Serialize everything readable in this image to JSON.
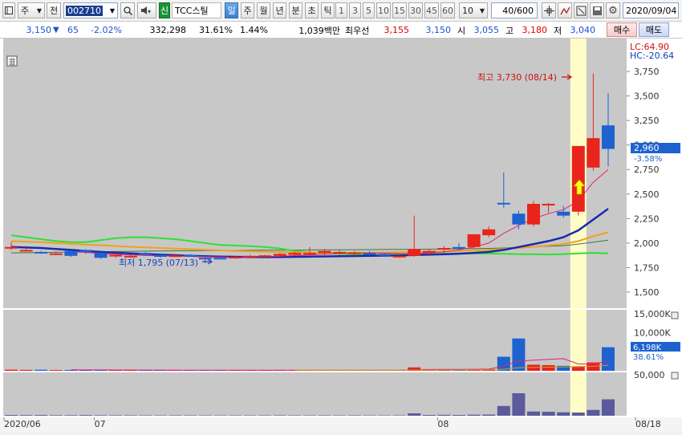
{
  "toolbar": {
    "market_label": "주",
    "prev_label": "전",
    "code": "002710",
    "badge": "신",
    "name": "TCC스틸",
    "periods": [
      "일",
      "주",
      "월",
      "년",
      "분",
      "초",
      "틱"
    ],
    "selected_period": "일",
    "intervals": [
      "1",
      "3",
      "5",
      "10",
      "15",
      "30",
      "45",
      "60"
    ],
    "interval_value": "10",
    "count": "40/600",
    "date": "2020/09/04"
  },
  "quote": {
    "price": "3,150",
    "change": "65",
    "change_pct": "-2.02%",
    "volume": "332,298",
    "ratio1": "31.61%",
    "ratio2": "1.44%",
    "amount": "1,039백만",
    "best_bid_label": "최우선",
    "best_ask": "3,155",
    "best_bid": "3,150",
    "open_label": "시",
    "open": "3,055",
    "high_label": "고",
    "high": "3,180",
    "low_label": "저",
    "low": "3,040",
    "buy_label": "매수",
    "sell_label": "매도"
  },
  "indicators": {
    "lc": "LC:64.90",
    "hc": "HC:-20.64"
  },
  "annotations": {
    "high_note": "최고 3,730 (08/14)",
    "low_note": "최저 1,795 (07/13)"
  },
  "price_tag": "2,960",
  "price_tag_pct": "-3.58%",
  "volume_tag": "6,198K",
  "volume_tag_pct": "38.61%",
  "colors": {
    "up": "#e8241c",
    "down": "#1e62d0",
    "highlight": "#fffcc8",
    "ma5": "#e0207a",
    "ma20": "#1a2aa8",
    "ma60": "#f0a020",
    "ma120": "#30e030",
    "ma240": "#3a7a3a"
  },
  "chart_data": {
    "type": "candlestick",
    "price_ticks": [
      "3,750",
      "3,500",
      "3,250",
      "3,000",
      "2,750",
      "2,500",
      "2,250",
      "2,000",
      "1,750",
      "1,500"
    ],
    "volume_ticks": [
      "15,000K",
      "10,000K"
    ],
    "volume2_ticks": [
      "50,000"
    ],
    "x_labels": [
      {
        "label": "2020/06",
        "index": 0
      },
      {
        "label": "07",
        "index": 6
      },
      {
        "label": "08",
        "index": 29
      },
      {
        "label": "08/18",
        "index": 42
      }
    ],
    "highlight_index": 38,
    "candles": [
      {
        "o": 1950,
        "h": 2010,
        "l": 1930,
        "c": 1960
      },
      {
        "o": 1930,
        "h": 1960,
        "l": 1920,
        "c": 1930
      },
      {
        "o": 1910,
        "h": 1920,
        "l": 1890,
        "c": 1900
      },
      {
        "o": 1890,
        "h": 1915,
        "l": 1880,
        "c": 1895
      },
      {
        "o": 1920,
        "h": 1930,
        "l": 1860,
        "c": 1870
      },
      {
        "o": 1930,
        "h": 1940,
        "l": 1890,
        "c": 1910
      },
      {
        "o": 1900,
        "h": 1910,
        "l": 1840,
        "c": 1850
      },
      {
        "o": 1870,
        "h": 1890,
        "l": 1850,
        "c": 1880
      },
      {
        "o": 1860,
        "h": 1880,
        "l": 1850,
        "c": 1870
      },
      {
        "o": 1900,
        "h": 1910,
        "l": 1870,
        "c": 1880
      },
      {
        "o": 1880,
        "h": 1890,
        "l": 1850,
        "c": 1860
      },
      {
        "o": 1870,
        "h": 1890,
        "l": 1860,
        "c": 1875
      },
      {
        "o": 1880,
        "h": 1890,
        "l": 1860,
        "c": 1870
      },
      {
        "o": 1850,
        "h": 1860,
        "l": 1795,
        "c": 1840
      },
      {
        "o": 1850,
        "h": 1870,
        "l": 1840,
        "c": 1845
      },
      {
        "o": 1850,
        "h": 1870,
        "l": 1840,
        "c": 1860
      },
      {
        "o": 1860,
        "h": 1880,
        "l": 1850,
        "c": 1870
      },
      {
        "o": 1860,
        "h": 1880,
        "l": 1850,
        "c": 1875
      },
      {
        "o": 1870,
        "h": 1900,
        "l": 1860,
        "c": 1890
      },
      {
        "o": 1880,
        "h": 1910,
        "l": 1870,
        "c": 1900
      },
      {
        "o": 1895,
        "h": 1960,
        "l": 1880,
        "c": 1900
      },
      {
        "o": 1900,
        "h": 1940,
        "l": 1880,
        "c": 1920
      },
      {
        "o": 1900,
        "h": 1930,
        "l": 1880,
        "c": 1910
      },
      {
        "o": 1900,
        "h": 1920,
        "l": 1880,
        "c": 1905
      },
      {
        "o": 1900,
        "h": 1920,
        "l": 1870,
        "c": 1880
      },
      {
        "o": 1890,
        "h": 1900,
        "l": 1860,
        "c": 1870
      },
      {
        "o": 1860,
        "h": 1880,
        "l": 1850,
        "c": 1870
      },
      {
        "o": 1870,
        "h": 2280,
        "l": 1860,
        "c": 1940
      },
      {
        "o": 1900,
        "h": 1940,
        "l": 1880,
        "c": 1920
      },
      {
        "o": 1940,
        "h": 1970,
        "l": 1900,
        "c": 1950
      },
      {
        "o": 1960,
        "h": 2000,
        "l": 1930,
        "c": 1950
      },
      {
        "o": 1960,
        "h": 2080,
        "l": 1950,
        "c": 2090
      },
      {
        "o": 2080,
        "h": 2170,
        "l": 2060,
        "c": 2140
      },
      {
        "o": 2410,
        "h": 2720,
        "l": 2360,
        "c": 2400
      },
      {
        "o": 2300,
        "h": 2330,
        "l": 2140,
        "c": 2190
      },
      {
        "o": 2190,
        "h": 2430,
        "l": 2170,
        "c": 2400
      },
      {
        "o": 2390,
        "h": 2410,
        "l": 2310,
        "c": 2400
      },
      {
        "o": 2320,
        "h": 2380,
        "l": 2260,
        "c": 2280
      },
      {
        "o": 2320,
        "h": 2350,
        "l": 2280,
        "c": 2990
      },
      {
        "o": 2770,
        "h": 3730,
        "l": 2740,
        "c": 3070
      },
      {
        "o": 3200,
        "h": 3530,
        "l": 2780,
        "c": 2960
      }
    ],
    "volume": [
      300,
      250,
      280,
      200,
      220,
      260,
      200,
      180,
      170,
      160,
      150,
      170,
      160,
      150,
      140,
      150,
      150,
      160,
      170,
      160,
      150,
      160,
      150,
      160,
      150,
      140,
      150,
      900,
      300,
      350,
      300,
      400,
      450,
      3700,
      8500,
      1600,
      1500,
      1300,
      1200,
      2200,
      6200
    ],
    "ma5": [
      null,
      null,
      null,
      null,
      1910,
      1905,
      1895,
      1885,
      1880,
      1875,
      1870,
      1868,
      1866,
      1862,
      1858,
      1855,
      1858,
      1862,
      1866,
      1872,
      1880,
      1888,
      1895,
      1898,
      1900,
      1898,
      1894,
      1890,
      1900,
      1910,
      1930,
      1960,
      2000,
      2100,
      2180,
      2250,
      2300,
      2340,
      2430,
      2620,
      2750
    ],
    "ma20": [
      1960,
      1955,
      1950,
      1940,
      1930,
      1920,
      1910,
      1902,
      1895,
      1888,
      1882,
      1876,
      1870,
      1866,
      1862,
      1860,
      1858,
      1857,
      1858,
      1860,
      1862,
      1864,
      1866,
      1868,
      1870,
      1872,
      1874,
      1878,
      1882,
      1886,
      1892,
      1900,
      1910,
      1930,
      1960,
      1990,
      2020,
      2060,
      2130,
      2240,
      2350
    ],
    "ma60": [
      2020,
      2015,
      2008,
      2000,
      1992,
      1985,
      1978,
      1970,
      1962,
      1956,
      1950,
      1944,
      1938,
      1932,
      1926,
      1920,
      1916,
      1912,
      1908,
      1905,
      1903,
      1902,
      1901,
      1901,
      1902,
      1904,
      1906,
      1909,
      1912,
      1916,
      1920,
      1926,
      1932,
      1940,
      1950,
      1962,
      1976,
      1990,
      2020,
      2070,
      2110
    ],
    "ma120": [
      2080,
      2060,
      2040,
      2020,
      2010,
      2010,
      2030,
      2050,
      2060,
      2060,
      2050,
      2040,
      2020,
      2000,
      1980,
      1975,
      1970,
      1960,
      1945,
      1920,
      1905,
      1895,
      1890,
      1885,
      1880,
      1880,
      1882,
      1885,
      1888,
      1892,
      1895,
      1895,
      1893,
      1890,
      1888,
      1886,
      1884,
      1888,
      1895,
      1900,
      1895
    ],
    "ma240": [
      1900,
      1902,
      1904,
      1906,
      1908,
      1910,
      1912,
      1914,
      1916,
      1918,
      1920,
      1921,
      1922,
      1923,
      1924,
      1925,
      1926,
      1927,
      1928,
      1929,
      1930,
      1931,
      1932,
      1933,
      1934,
      1935,
      1936,
      1937,
      1938,
      1940,
      1942,
      1944,
      1946,
      1950,
      1956,
      1962,
      1968,
      1974,
      1990,
      2010,
      2030
    ],
    "vol_ma5": [
      null,
      null,
      null,
      null,
      250,
      240,
      230,
      220,
      210,
      200,
      180,
      170,
      165,
      160,
      160,
      160,
      155,
      150,
      150,
      150,
      150,
      150,
      150,
      150,
      150,
      155,
      155,
      300,
      330,
      360,
      380,
      400,
      450,
      1200,
      2600,
      2800,
      3000,
      3200,
      1800,
      1800,
      2600
    ],
    "vol_ma20": [
      null,
      null,
      null,
      null,
      null,
      null,
      null,
      null,
      null,
      null,
      null,
      null,
      null,
      null,
      null,
      null,
      null,
      null,
      null,
      180,
      175,
      170,
      168,
      165,
      162,
      160,
      160,
      195,
      200,
      210,
      215,
      225,
      240,
      410,
      830,
      900,
      960,
      1020,
      1070,
      1180,
      1470
    ]
  }
}
